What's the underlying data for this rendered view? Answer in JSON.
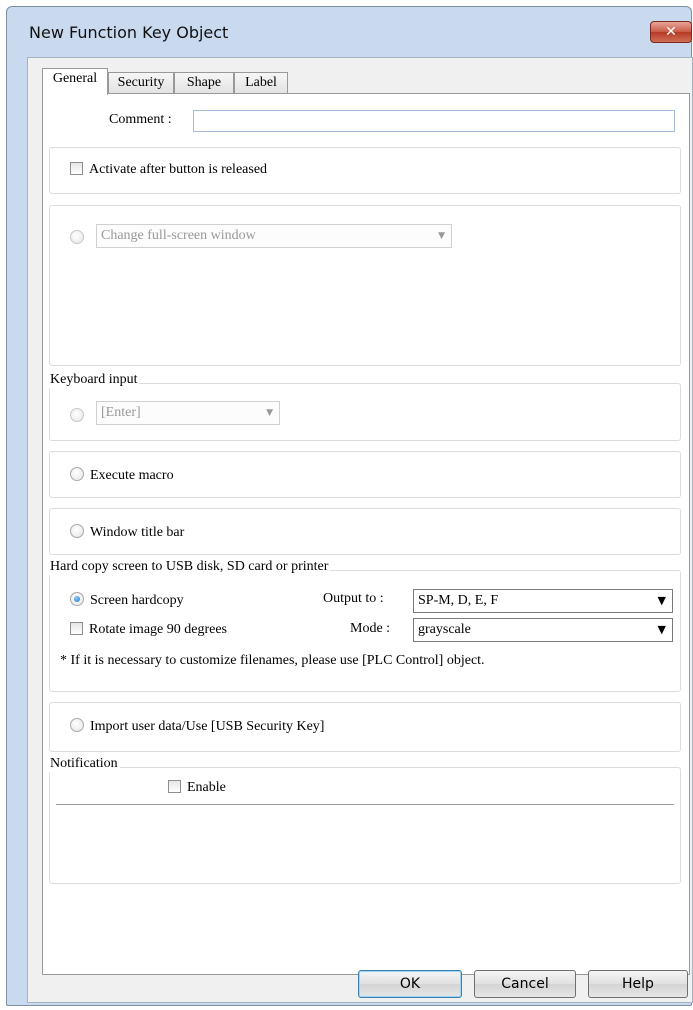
{
  "window": {
    "title": "New Function Key Object"
  },
  "tabs": [
    "General",
    "Security",
    "Shape",
    "Label"
  ],
  "comment": {
    "label": "Comment :",
    "value": ""
  },
  "activate_after_release": {
    "label": "Activate after button is released",
    "checked": false
  },
  "change_window": {
    "selected": "Change full-screen window"
  },
  "keyboard_input": {
    "legend": "Keyboard input",
    "selected": "[Enter]"
  },
  "execute_macro": {
    "label": "Execute macro"
  },
  "window_title_bar": {
    "label": "Window title bar"
  },
  "hardcopy": {
    "legend": "Hard copy screen to USB disk, SD card or printer",
    "screen_hardcopy_label": "Screen hardcopy",
    "output_to_label": "Output to :",
    "output_to_value": "SP-M, D, E, F",
    "rotate_label": "Rotate image 90 degrees",
    "mode_label": "Mode :",
    "mode_value": "grayscale",
    "note": "* If it is necessary to customize filenames, please use [PLC Control] object."
  },
  "import_user_data": {
    "label": "Import user data/Use [USB Security Key]"
  },
  "notification": {
    "legend": "Notification",
    "enable_label": "Enable",
    "checked": false
  },
  "buttons": {
    "ok": "OK",
    "cancel": "Cancel",
    "help": "Help"
  },
  "icons": {
    "close": "close-icon",
    "dropdown": "chevron-down-icon"
  },
  "colors": {
    "window_frame": "#c9d9ee",
    "close_button": "#c95a45",
    "radio_selected": "#1a6fc0"
  }
}
